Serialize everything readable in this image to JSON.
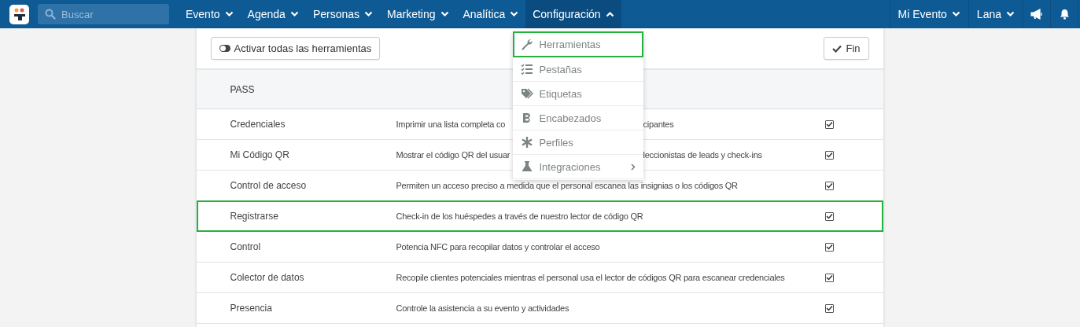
{
  "navbar": {
    "search": {
      "placeholder": "Buscar"
    },
    "menus": [
      {
        "label": "Evento",
        "expanded": false
      },
      {
        "label": "Agenda",
        "expanded": false
      },
      {
        "label": "Personas",
        "expanded": false
      },
      {
        "label": "Marketing",
        "expanded": false
      },
      {
        "label": "Analítica",
        "expanded": false
      },
      {
        "label": "Configuración",
        "expanded": true
      }
    ],
    "right_menus": [
      {
        "label": "Mi Evento",
        "expanded": false
      },
      {
        "label": "Lana",
        "expanded": false
      }
    ]
  },
  "toolbar": {
    "toggle_all_button": "Activar todas las herramientas",
    "done_button": "Fin"
  },
  "dropdown": [
    {
      "kind": "wrench",
      "label": "Herramientas",
      "highlighted": true
    },
    {
      "kind": "list",
      "label": "Pestañas",
      "highlighted": false
    },
    {
      "kind": "tags",
      "label": "Etiquetas",
      "highlighted": false
    },
    {
      "kind": "bold",
      "label": "Encabezados",
      "highlighted": false
    },
    {
      "kind": "asterisk",
      "label": "Perfiles",
      "highlighted": false
    },
    {
      "kind": "flask",
      "label": "Integraciones",
      "highlighted": false,
      "submenu": true
    }
  ],
  "table": {
    "section": "PASS",
    "rows": [
      {
        "name": "Credenciales",
        "description_parts": [
          "Imprimir una lista completa co",
          "cipantes"
        ],
        "checked": true,
        "highlighted": false
      },
      {
        "name": "Mi Código QR",
        "description_parts": [
          "Mostrar el código QR del usuar",
          "leccionistas de leads y check-ins"
        ],
        "checked": true,
        "highlighted": false
      },
      {
        "name": "Control de acceso",
        "description_parts": [
          "Permiten un acceso preciso a medida que el personal escanea las insignias o los códigos QR"
        ],
        "checked": true,
        "highlighted": false
      },
      {
        "name": "Registrarse",
        "description_parts": [
          "Check-in de los huéspedes a través de nuestro lector de código QR"
        ],
        "checked": true,
        "highlighted": true
      },
      {
        "name": "Control",
        "description_parts": [
          "Potencia NFC para recopilar datos y controlar el acceso"
        ],
        "checked": true,
        "highlighted": false
      },
      {
        "name": "Colector de datos",
        "description_parts": [
          "Recopile clientes potenciales mientras el personal usa el lector de códigos QR para escanear credenciales"
        ],
        "checked": true,
        "highlighted": false
      },
      {
        "name": "Presencia",
        "description_parts": [
          "Controle la asistencia a su evento y actividades"
        ],
        "checked": true,
        "highlighted": false
      }
    ]
  }
}
